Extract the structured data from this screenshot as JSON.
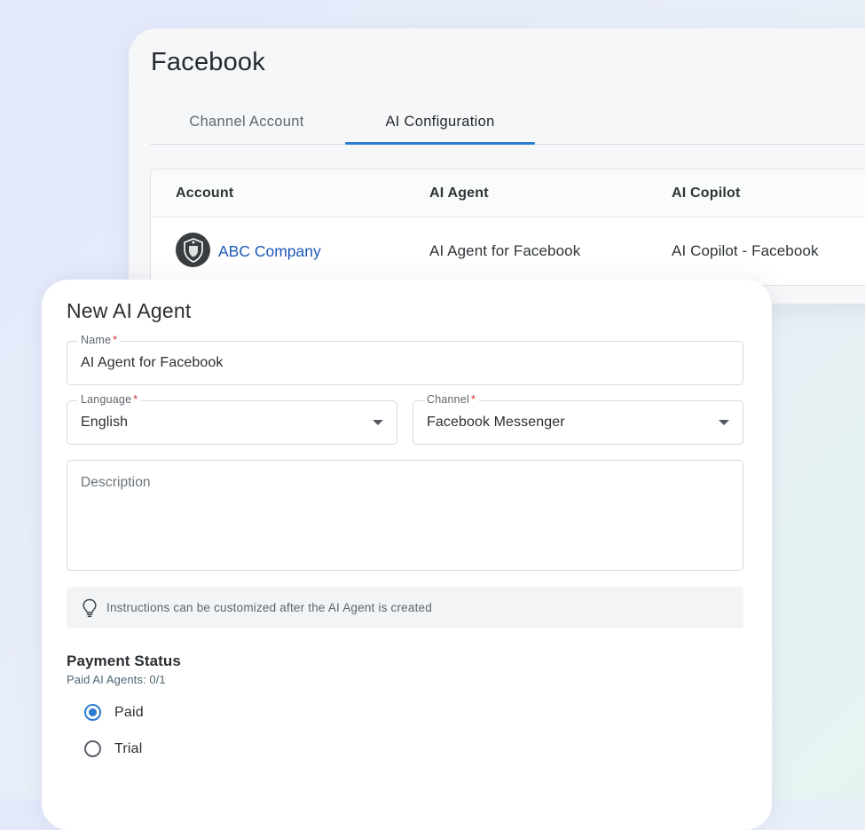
{
  "channel_page": {
    "title": "Facebook",
    "tabs": [
      {
        "label": "Channel Account"
      },
      {
        "label": "AI Configuration",
        "active": true
      }
    ],
    "table": {
      "headers": [
        "Account",
        "AI Agent",
        "AI Copilot"
      ],
      "rows": [
        {
          "account": "ABC Company",
          "ai_agent": "AI Agent for Facebook",
          "ai_copilot": "AI Copilot - Facebook",
          "logo_icon": "shield-crest-icon"
        }
      ]
    }
  },
  "dialog": {
    "title": "New AI Agent",
    "name": {
      "label": "Name",
      "required_mark": "*",
      "value": "AI Agent for Facebook"
    },
    "language": {
      "label": "Language",
      "required_mark": "*",
      "value": "English"
    },
    "channel": {
      "label": "Channel",
      "required_mark": "*",
      "value": "Facebook Messenger"
    },
    "description": {
      "placeholder": "Description"
    },
    "hint": {
      "icon": "lightbulb-icon",
      "text": "Instructions can be customized after the AI Agent is created"
    },
    "payment": {
      "title": "Payment Status",
      "subtitle": "Paid AI Agents: 0/1",
      "options": [
        {
          "label": "Paid",
          "selected": true
        },
        {
          "label": "Trial",
          "selected": false
        }
      ]
    }
  },
  "colors": {
    "accent": "#2b7bd0",
    "link": "#1f58b8",
    "required": "#d32f2f"
  }
}
